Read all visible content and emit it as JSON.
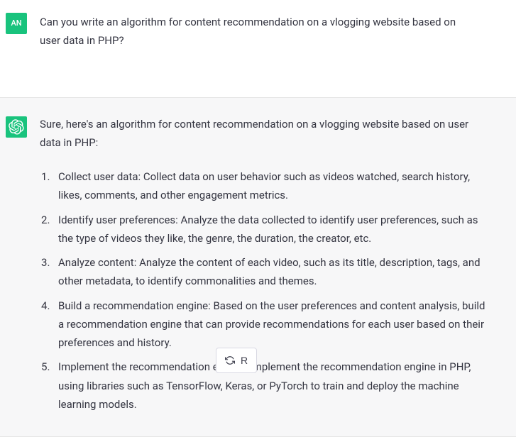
{
  "user": {
    "avatar_label": "AN",
    "message": "Can you write an algorithm for content recommendation on a vlogging website based on user data in PHP?"
  },
  "assistant": {
    "intro": "Sure, here's an algorithm for content recommendation on a vlogging website based on user data in PHP:",
    "steps": [
      "Collect user data: Collect data on user behavior such as videos watched, search history, likes, comments, and other engagement metrics.",
      "Identify user preferences: Analyze the data collected to identify user preferences, such as the type of videos they like, the genre, the duration, the creator, etc.",
      "Analyze content: Analyze the content of each video, such as its title, description, tags, and other metadata, to identify commonalities and themes.",
      "Build a recommendation engine: Based on the user preferences and content analysis, build a recommendation engine that can provide recommendations for each user based on their preferences and history.",
      "Implement the recommendation engine: Implement the recommendation engine in PHP, using libraries such as TensorFlow, Keras, or PyTorch to train and deploy the machine learning models."
    ]
  },
  "regenerate_label": "R"
}
